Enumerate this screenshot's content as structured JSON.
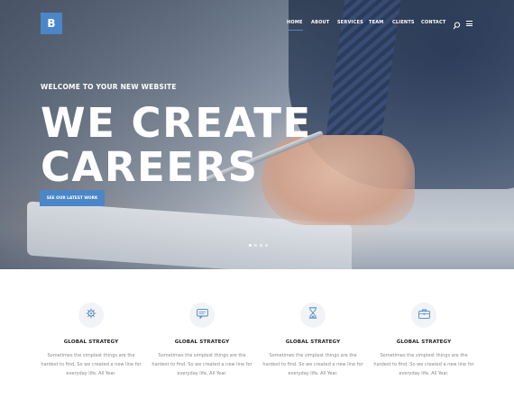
{
  "brand": {
    "logo_letter": "B",
    "accent_color": "#4a86c8"
  },
  "nav": {
    "items": [
      {
        "label": "HOME",
        "active": true
      },
      {
        "label": "ABOUT",
        "active": false
      },
      {
        "label": "SERVICES",
        "active": false
      },
      {
        "label": "TEAM",
        "active": false
      },
      {
        "label": "CLIENTS",
        "active": false
      },
      {
        "label": "CONTACT",
        "active": false
      }
    ],
    "search_icon": "search-icon",
    "menu_icon": "hamburger-menu-icon"
  },
  "hero": {
    "welcome": "WELCOME TO YOUR NEW WEBSITE",
    "headline_line1": "WE CREATE",
    "headline_line2": "CAREERS",
    "cta_label": "SEE OUR LATEST WORK",
    "slider": {
      "total": 4,
      "active": 1
    }
  },
  "features": [
    {
      "icon": "ship-wheel-icon",
      "title": "GLOBAL STRATEGY",
      "text_line1": "Sometimes the simplest things are the",
      "text_line2": "hardest to find. So we created a new line for",
      "text_line3": "everyday life, All Year."
    },
    {
      "icon": "chat-bubble-icon",
      "title": "GLOBAL STRATEGY",
      "text_line1": "Sometimes the simplest things are the",
      "text_line2": "hardest to find. So we created a new line for",
      "text_line3": "everyday life, All Year."
    },
    {
      "icon": "hourglass-icon",
      "title": "GLOBAL STRATEGY",
      "text_line1": "Sometimes the simplest things are the",
      "text_line2": "hardest to find. So we created a new line for",
      "text_line3": "everyday life, All Year."
    },
    {
      "icon": "briefcase-icon",
      "title": "GLOBAL STRATEGY",
      "text_line1": "Sometimes the simplest things are the",
      "text_line2": "hardest to find. So we created a new line for",
      "text_line3": "everyday life, All Year."
    }
  ]
}
